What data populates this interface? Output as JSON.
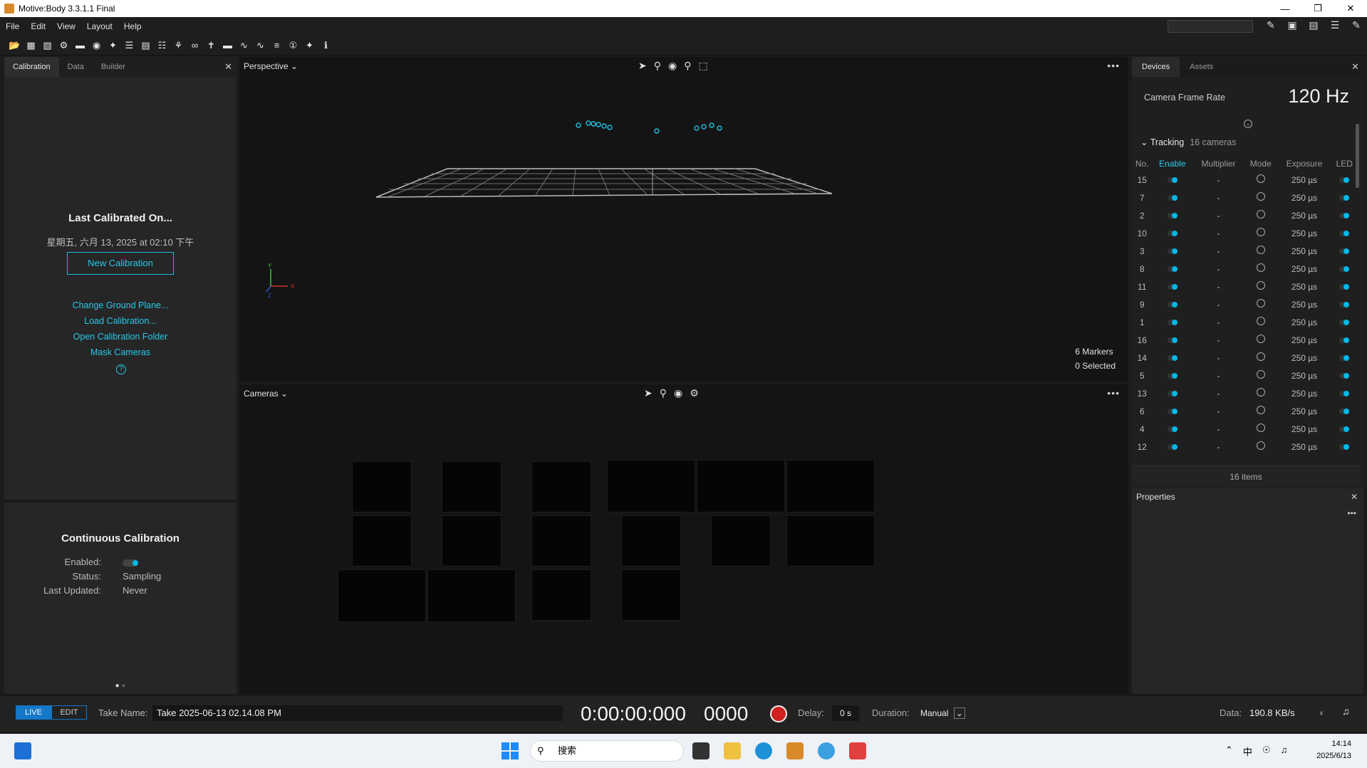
{
  "window": {
    "title": "Motive:Body 3.3.1.1 Final"
  },
  "menu": {
    "items": [
      "File",
      "Edit",
      "View",
      "Layout",
      "Help"
    ]
  },
  "left_panel": {
    "tabs": [
      "Calibration",
      "Data",
      "Builder"
    ],
    "last_calibrated_title": "Last Calibrated On...",
    "last_calibrated_date": "星期五, 六月 13, 2025 at 02:10 下午",
    "new_calibration_label": "New Calibration",
    "links": [
      "Change Ground Plane...",
      "Load Calibration...",
      "Open Calibration Folder",
      "Mask Cameras"
    ],
    "help_icon": "?",
    "continuous": {
      "title": "Continuous Calibration",
      "enabled_label": "Enabled:",
      "status_label": "Status:",
      "status_value": "Sampling",
      "updated_label": "Last Updated:",
      "updated_value": "Never"
    }
  },
  "viewport": {
    "view_name": "Perspective",
    "markers": "6 Markers",
    "selected": "0 Selected",
    "axis_y": "Y",
    "axis_x": "X",
    "axis_z": "Z"
  },
  "cameras_view": {
    "view_name": "Cameras"
  },
  "right_panel": {
    "tabs": [
      "Devices",
      "Assets"
    ],
    "camera_frame_rate_label": "Camera Frame Rate",
    "camera_frame_rate_value": "120 Hz",
    "tracking_label": "Tracking",
    "tracking_count": "16 cameras",
    "columns": [
      "No.",
      "Enable",
      "Multiplier",
      "Mode",
      "Exposure",
      "LED"
    ],
    "cameras": [
      {
        "no": "15",
        "multiplier": "-",
        "exposure": "250 µs"
      },
      {
        "no": "7",
        "multiplier": "-",
        "exposure": "250 µs"
      },
      {
        "no": "2",
        "multiplier": "-",
        "exposure": "250 µs"
      },
      {
        "no": "10",
        "multiplier": "-",
        "exposure": "250 µs"
      },
      {
        "no": "3",
        "multiplier": "-",
        "exposure": "250 µs"
      },
      {
        "no": "8",
        "multiplier": "-",
        "exposure": "250 µs"
      },
      {
        "no": "11",
        "multiplier": "-",
        "exposure": "250 µs"
      },
      {
        "no": "9",
        "multiplier": "-",
        "exposure": "250 µs"
      },
      {
        "no": "1",
        "multiplier": "-",
        "exposure": "250 µs"
      },
      {
        "no": "16",
        "multiplier": "-",
        "exposure": "250 µs"
      },
      {
        "no": "14",
        "multiplier": "-",
        "exposure": "250 µs"
      },
      {
        "no": "5",
        "multiplier": "-",
        "exposure": "250 µs"
      },
      {
        "no": "13",
        "multiplier": "-",
        "exposure": "250 µs"
      },
      {
        "no": "6",
        "multiplier": "-",
        "exposure": "250 µs"
      },
      {
        "no": "4",
        "multiplier": "-",
        "exposure": "250 µs"
      },
      {
        "no": "12",
        "multiplier": "-",
        "exposure": "250 µs"
      }
    ],
    "items_count": "16 items",
    "properties_title": "Properties"
  },
  "status_bar": {
    "live_label": "LIVE",
    "edit_label": "EDIT",
    "take_name_label": "Take Name:",
    "take_name_value": "Take 2025-06-13 02.14.08 PM",
    "timecode": "0:00:00:000",
    "frame": "0000",
    "delay_label": "Delay:",
    "delay_value": "0 s",
    "duration_label": "Duration:",
    "duration_value": "Manual",
    "data_label": "Data:",
    "data_value": "190.8 KB/s"
  },
  "taskbar": {
    "search_placeholder": "搜索",
    "time": "14:14",
    "date": "2025/6/13",
    "ime": "中"
  },
  "colors": {
    "accent": "#27c9ea",
    "record": "#d02020",
    "live": "#1477c8"
  }
}
